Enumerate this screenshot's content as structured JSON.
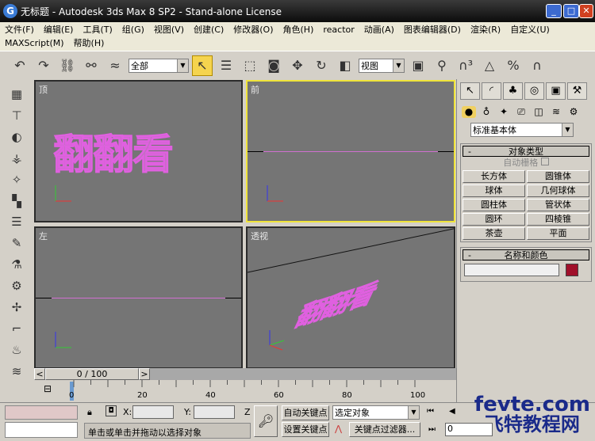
{
  "window": {
    "title": "无标题 - Autodesk 3ds Max 8 SP2  - Stand-alone License",
    "logo": "G"
  },
  "menu": {
    "row1": [
      "文件(F)",
      "编辑(E)",
      "工具(T)",
      "组(G)",
      "视图(V)",
      "创建(C)",
      "修改器(O)",
      "角色(H)",
      "reactor",
      "动画(A)",
      "图表编辑器(D)",
      "渲染(R)",
      "自定义(U)"
    ],
    "row2": [
      "MAXScript(M)",
      "帮助(H)"
    ]
  },
  "toolbar": {
    "selection_filter": "全部",
    "reference_coord": "视图"
  },
  "viewports": [
    {
      "label": "顶",
      "text": "翻翻看"
    },
    {
      "label": "前"
    },
    {
      "label": "左"
    },
    {
      "label": "透视",
      "text": "翻翻看"
    }
  ],
  "axes": {
    "x": "x",
    "y": "y",
    "z": "z"
  },
  "panel": {
    "category": "标准基本体",
    "rollout1": "对象类型",
    "autogrid": "自动栅格",
    "buttons": [
      "长方体",
      "圆锥体",
      "球体",
      "几何球体",
      "圆柱体",
      "管状体",
      "圆环",
      "四棱锥",
      "茶壶",
      "平面"
    ],
    "rollout2": "名称和颜色",
    "name_value": "",
    "color": "#a0102a"
  },
  "timeslider": {
    "value": "0 / 100"
  },
  "timeline": {
    "ticks": [
      "0",
      "20",
      "40",
      "60",
      "80",
      "100"
    ]
  },
  "status": {
    "x_label": "X:",
    "y_label": "Y:",
    "z_label": "Z",
    "prompt": "单击或单击并拖动以选择对象",
    "auto_key": "自动关键点",
    "set_key": "设置关键点",
    "key_mode": "选定对象",
    "key_filters": "关键点过滤器...",
    "frame": "0"
  },
  "watermark": {
    "line1": "fevte.com",
    "line2": "飞特教程网"
  }
}
